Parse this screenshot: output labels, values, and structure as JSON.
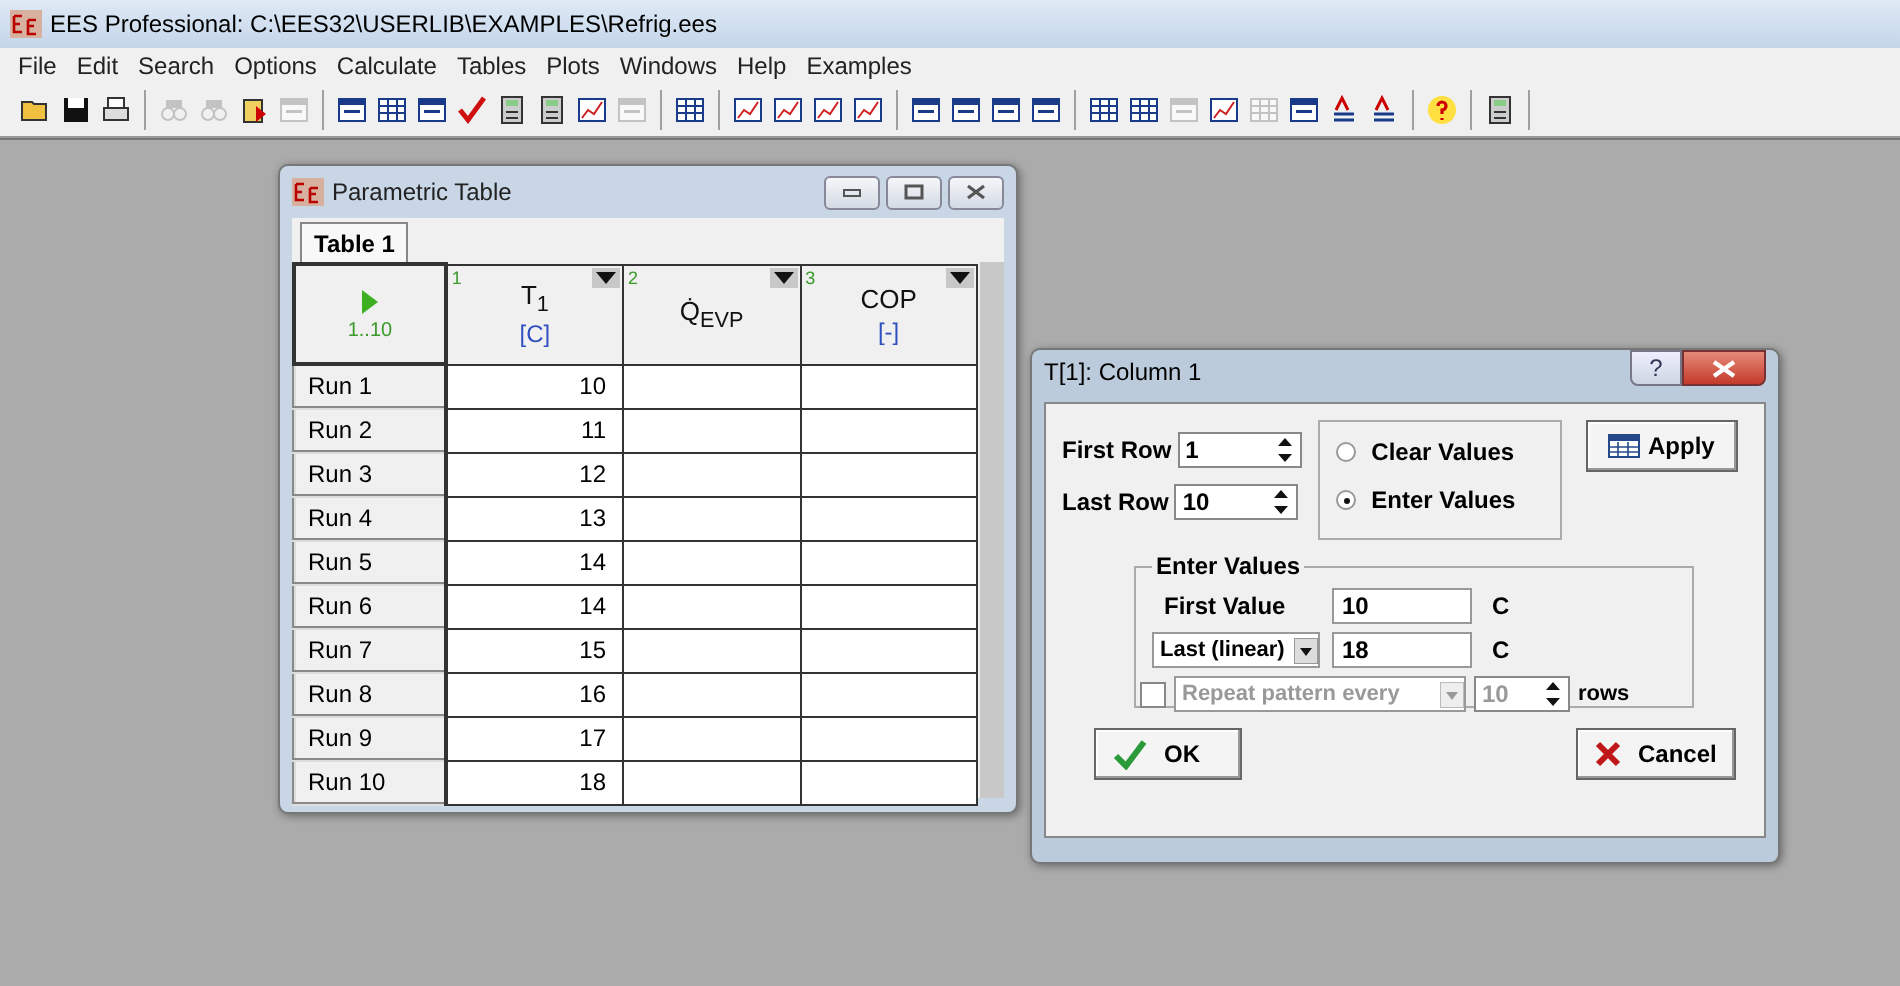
{
  "app": {
    "title": "EES Professional:  C:\\EES32\\USERLIB\\EXAMPLES\\Refrig.ees"
  },
  "menu": [
    "File",
    "Edit",
    "Search",
    "Options",
    "Calculate",
    "Tables",
    "Plots",
    "Windows",
    "Help",
    "Examples"
  ],
  "toolbar": [
    [
      {
        "kind": "folder",
        "disabled": false
      },
      {
        "kind": "disk",
        "disabled": false
      },
      {
        "kind": "printer",
        "disabled": false
      }
    ],
    [
      {
        "kind": "binoculars",
        "disabled": true
      },
      {
        "kind": "binoculars",
        "disabled": true
      },
      {
        "kind": "clipboard",
        "disabled": false
      },
      {
        "kind": "window",
        "disabled": true
      }
    ],
    [
      {
        "kind": "window",
        "disabled": false
      },
      {
        "kind": "table",
        "disabled": false
      },
      {
        "kind": "window",
        "disabled": false
      },
      {
        "kind": "check",
        "disabled": false
      },
      {
        "kind": "calculator",
        "disabled": false
      },
      {
        "kind": "calculator",
        "disabled": false
      },
      {
        "kind": "chart",
        "disabled": false
      },
      {
        "kind": "window",
        "disabled": true
      }
    ],
    [
      {
        "kind": "table",
        "disabled": false
      }
    ],
    [
      {
        "kind": "chart",
        "disabled": false
      },
      {
        "kind": "chart",
        "disabled": false
      },
      {
        "kind": "chart",
        "disabled": false
      },
      {
        "kind": "chart",
        "disabled": false
      }
    ],
    [
      {
        "kind": "window",
        "disabled": false
      },
      {
        "kind": "window",
        "disabled": false
      },
      {
        "kind": "window",
        "disabled": false
      },
      {
        "kind": "window",
        "disabled": false
      }
    ],
    [
      {
        "kind": "table",
        "disabled": false
      },
      {
        "kind": "table",
        "disabled": false
      },
      {
        "kind": "window",
        "disabled": true
      },
      {
        "kind": "chart",
        "disabled": false
      },
      {
        "kind": "table",
        "disabled": true
      },
      {
        "kind": "window",
        "disabled": false
      },
      {
        "kind": "text",
        "disabled": false
      },
      {
        "kind": "text",
        "disabled": false
      }
    ],
    [
      {
        "kind": "help",
        "disabled": false
      }
    ],
    [
      {
        "kind": "calculator",
        "disabled": false
      }
    ]
  ],
  "parametric_window": {
    "title": "Parametric Table",
    "tabs": [
      {
        "label": "Table 1",
        "selected": true
      }
    ],
    "corner": {
      "label": "1..10"
    },
    "columns": [
      {
        "number": "1",
        "name": "T$_{1}$",
        "unit": "[C]"
      },
      {
        "number": "2",
        "name": "Q̇$_{EVP}$"
      },
      {
        "number": "3",
        "name": "COP",
        "unit": "[-]"
      }
    ],
    "rows": [
      {
        "label": "Run 1",
        "cells": [
          "10",
          "",
          ""
        ]
      },
      {
        "label": "Run 2",
        "cells": [
          "11",
          "",
          ""
        ]
      },
      {
        "label": "Run 3",
        "cells": [
          "12",
          "",
          ""
        ]
      },
      {
        "label": "Run 4",
        "cells": [
          "13",
          "",
          ""
        ]
      },
      {
        "label": "Run 5",
        "cells": [
          "14",
          "",
          ""
        ]
      },
      {
        "label": "Run 6",
        "cells": [
          "14",
          "",
          ""
        ]
      },
      {
        "label": "Run 7",
        "cells": [
          "15",
          "",
          ""
        ]
      },
      {
        "label": "Run 8",
        "cells": [
          "16",
          "",
          ""
        ]
      },
      {
        "label": "Run 9",
        "cells": [
          "17",
          "",
          ""
        ]
      },
      {
        "label": "Run 10",
        "cells": [
          "18",
          "",
          ""
        ]
      }
    ]
  },
  "dialog": {
    "title": "T[1]:  Column 1",
    "help": "?",
    "first_row": {
      "label": "First Row",
      "value": "1"
    },
    "last_row": {
      "label": "Last Row",
      "value": "10"
    },
    "radios": [
      {
        "label": "Clear Values",
        "selected": false
      },
      {
        "label": "Enter Values",
        "selected": true
      }
    ],
    "apply": "Apply",
    "group": {
      "title": "Enter Values",
      "first_value": {
        "label": "First Value",
        "value": "10",
        "unit": "C"
      },
      "last": {
        "mode": "Last (linear)",
        "value": "18",
        "unit": "C"
      },
      "repeat": {
        "checked": false,
        "mode": "Repeat pattern every",
        "value": "10",
        "suffix": "rows",
        "disabled": true
      }
    },
    "ok": "OK",
    "cancel": "Cancel"
  }
}
